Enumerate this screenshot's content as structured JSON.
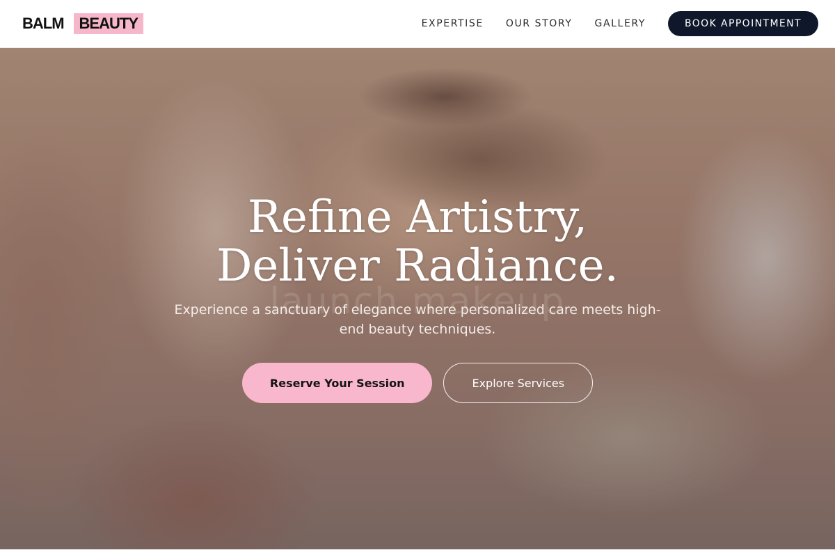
{
  "header": {
    "logo_part1": "BALM",
    "logo_part2": "BEAUTY",
    "nav": [
      {
        "label": "EXPERTISE"
      },
      {
        "label": "OUR STORY"
      },
      {
        "label": "GALLERY"
      }
    ],
    "cta_label": "BOOK APPOINTMENT"
  },
  "hero": {
    "title_line1": "Refine Artistry,",
    "title_line2": "Deliver Radiance.",
    "watermark": "launch makeup",
    "subtitle": "Experience a sanctuary of elegance where personalized care meets high-end beauty techniques.",
    "primary_cta": "Reserve Your Session",
    "secondary_cta": "Explore Services"
  },
  "colors": {
    "brand_pink": "#f8b7cc",
    "navy": "#0f172a"
  }
}
